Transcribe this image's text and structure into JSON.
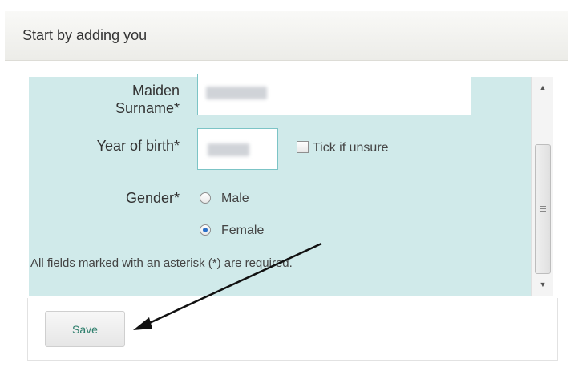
{
  "header": {
    "title": "Start by adding you"
  },
  "form": {
    "maiden_surname": {
      "label_line1": "Maiden",
      "label_line2": "Surname*"
    },
    "year_of_birth": {
      "label": "Year of birth*",
      "unsure_label": "Tick if unsure",
      "unsure_checked": false
    },
    "gender": {
      "label": "Gender*",
      "options": [
        {
          "label": "Male",
          "checked": false
        },
        {
          "label": "Female",
          "checked": true
        }
      ]
    },
    "required_note": "All fields marked with an asterisk (*) are required."
  },
  "footer": {
    "save_label": "Save"
  },
  "colors": {
    "panel": "#d0eaea",
    "input_border": "#7cc4c6",
    "radio_selected": "#2a6fc8",
    "save_text": "#2f7f6d"
  },
  "icons": {
    "scroll_up": "scroll-up-arrow-icon",
    "scroll_down": "scroll-down-arrow-icon",
    "annotation": "annotation-arrow-icon"
  }
}
